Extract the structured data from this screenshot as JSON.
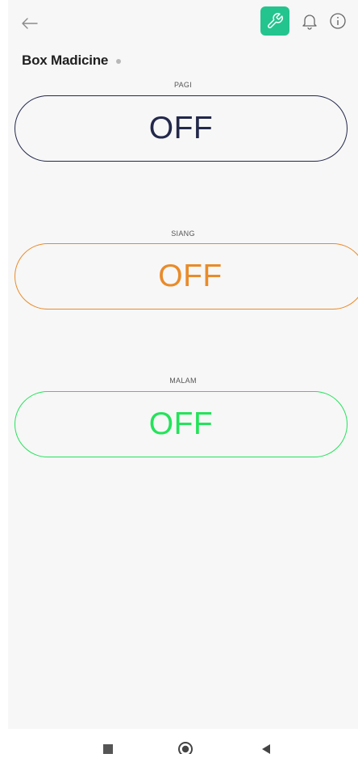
{
  "device": {
    "title": "Box Madicine",
    "status": "offline"
  },
  "colors": {
    "wrench_bg": "#23c48e",
    "pagi": "#23284b",
    "siang": "#e98b2a",
    "malam": "#23e35a"
  },
  "toolbar": {
    "back_icon": "arrow-left-icon",
    "wrench_icon": "wrench-icon",
    "bell_icon": "bell-icon",
    "info_icon": "info-icon"
  },
  "widgets": [
    {
      "label": "PAGI",
      "value": "OFF"
    },
    {
      "label": "SIANG",
      "value": "OFF"
    },
    {
      "label": "MALAM",
      "value": "OFF"
    }
  ],
  "nav": {
    "recents_icon": "square-icon",
    "home_icon": "home-circle-icon",
    "back_icon": "triangle-back-icon"
  }
}
